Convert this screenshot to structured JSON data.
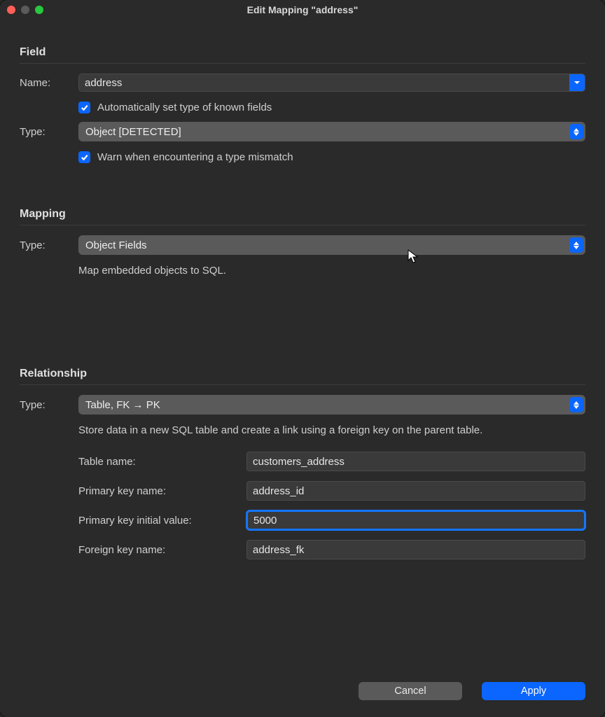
{
  "window": {
    "title": "Edit Mapping \"address\""
  },
  "field": {
    "heading": "Field",
    "name_label": "Name:",
    "name_value": "address",
    "auto_type_label": "Automatically set type of known fields",
    "type_label": "Type:",
    "type_value": "Object [DETECTED]",
    "warn_label": "Warn when encountering a type mismatch"
  },
  "mapping": {
    "heading": "Mapping",
    "type_label": "Type:",
    "type_value": "Object Fields",
    "description": "Map embedded objects to SQL."
  },
  "relationship": {
    "heading": "Relationship",
    "type_label": "Type:",
    "type_value": "Table, FK → PK",
    "description": "Store data in a new SQL table and create a link using a foreign key on the parent table.",
    "rows": {
      "table_name": {
        "label": "Table name:",
        "value": "customers_address"
      },
      "primary_key_name": {
        "label": "Primary key name:",
        "value": "address_id"
      },
      "primary_key_init": {
        "label": "Primary key initial value:",
        "value": "5000"
      },
      "foreign_key_name": {
        "label": "Foreign key name:",
        "value": "address_fk"
      }
    }
  },
  "buttons": {
    "cancel": "Cancel",
    "apply": "Apply"
  }
}
